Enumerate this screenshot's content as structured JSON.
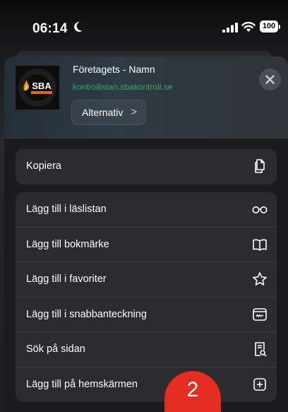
{
  "status_bar": {
    "time": "06:14",
    "battery": "100",
    "icons": [
      "moon-icon",
      "signal-icon",
      "wifi-icon",
      "battery-icon"
    ]
  },
  "header": {
    "title": "Företagets - Namn",
    "url": "kontrollistan.sbakontroll.se",
    "options_label": "Alternativ",
    "options_chevron": ">",
    "logo_text": "SBA",
    "close_icon": "close-icon"
  },
  "groups": [
    {
      "items": [
        {
          "label": "Kopiera",
          "icon": "copy-icon"
        }
      ]
    },
    {
      "items": [
        {
          "label": "Lägg till i läslistan",
          "icon": "glasses-icon"
        },
        {
          "label": "Lägg till bokmärke",
          "icon": "book-icon"
        },
        {
          "label": "Lägg till i favoriter",
          "icon": "star-icon"
        },
        {
          "label": "Lägg till i snabbanteckning",
          "icon": "quick-note-icon"
        },
        {
          "label": "Sök på sidan",
          "icon": "find-in-page-icon"
        },
        {
          "label": "Lägg till på hemskärmen",
          "icon": "add-square-icon"
        }
      ]
    }
  ],
  "badge": {
    "label": "2"
  },
  "colors": {
    "sheet": "#1c1c1e",
    "group": "#2c2c2e",
    "url": "#3dba6e",
    "badge": "#e42c23"
  }
}
